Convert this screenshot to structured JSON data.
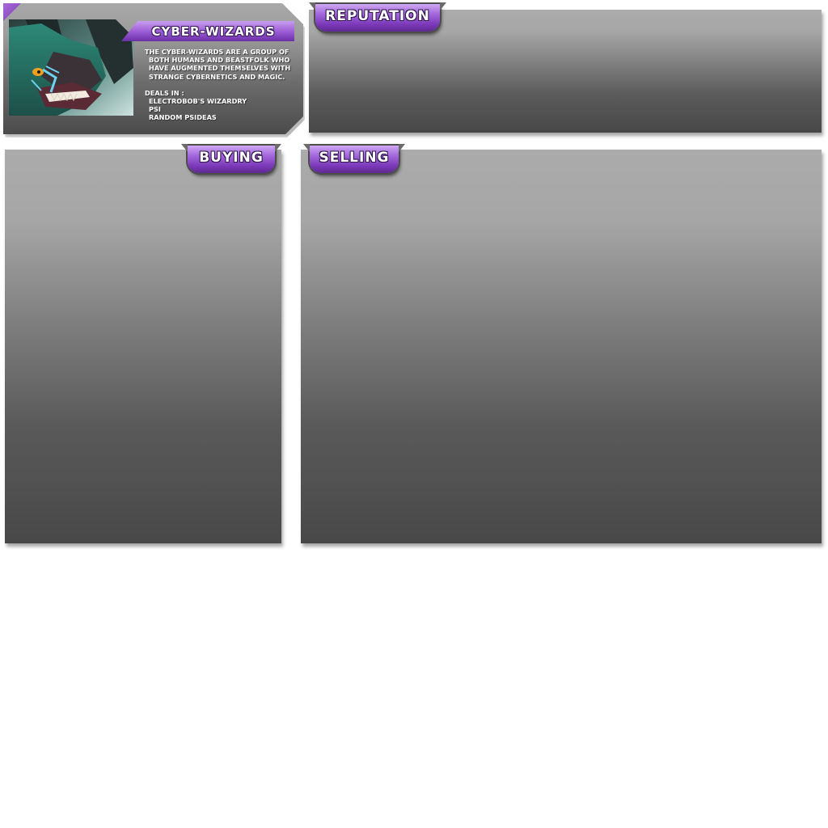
{
  "faction": {
    "name": "CYBER-WIZARDS",
    "description_lines": [
      "THE CYBER-WIZARDS ARE A GROUP OF",
      "BOTH HUMANS AND BEASTFOLK WHO",
      "HAVE AUGMENTED THEMSELVES WITH",
      "STRANGE CYBERNETICS AND MAGIC."
    ],
    "deals_in_label": "DEALS IN :",
    "deals_in": [
      "ELECTROBOB'S WIZARDRY",
      "PSI",
      "RANDOM PSIDEAS"
    ],
    "portrait_icon": "wolf-beastfolk-portrait"
  },
  "panels": {
    "reputation": "REPUTATION",
    "buying": "BUYING",
    "selling": "SELLING"
  },
  "colors": {
    "accent_purple": "#9d5fd6",
    "panel_top": "#ababab",
    "panel_bottom": "#484848"
  }
}
